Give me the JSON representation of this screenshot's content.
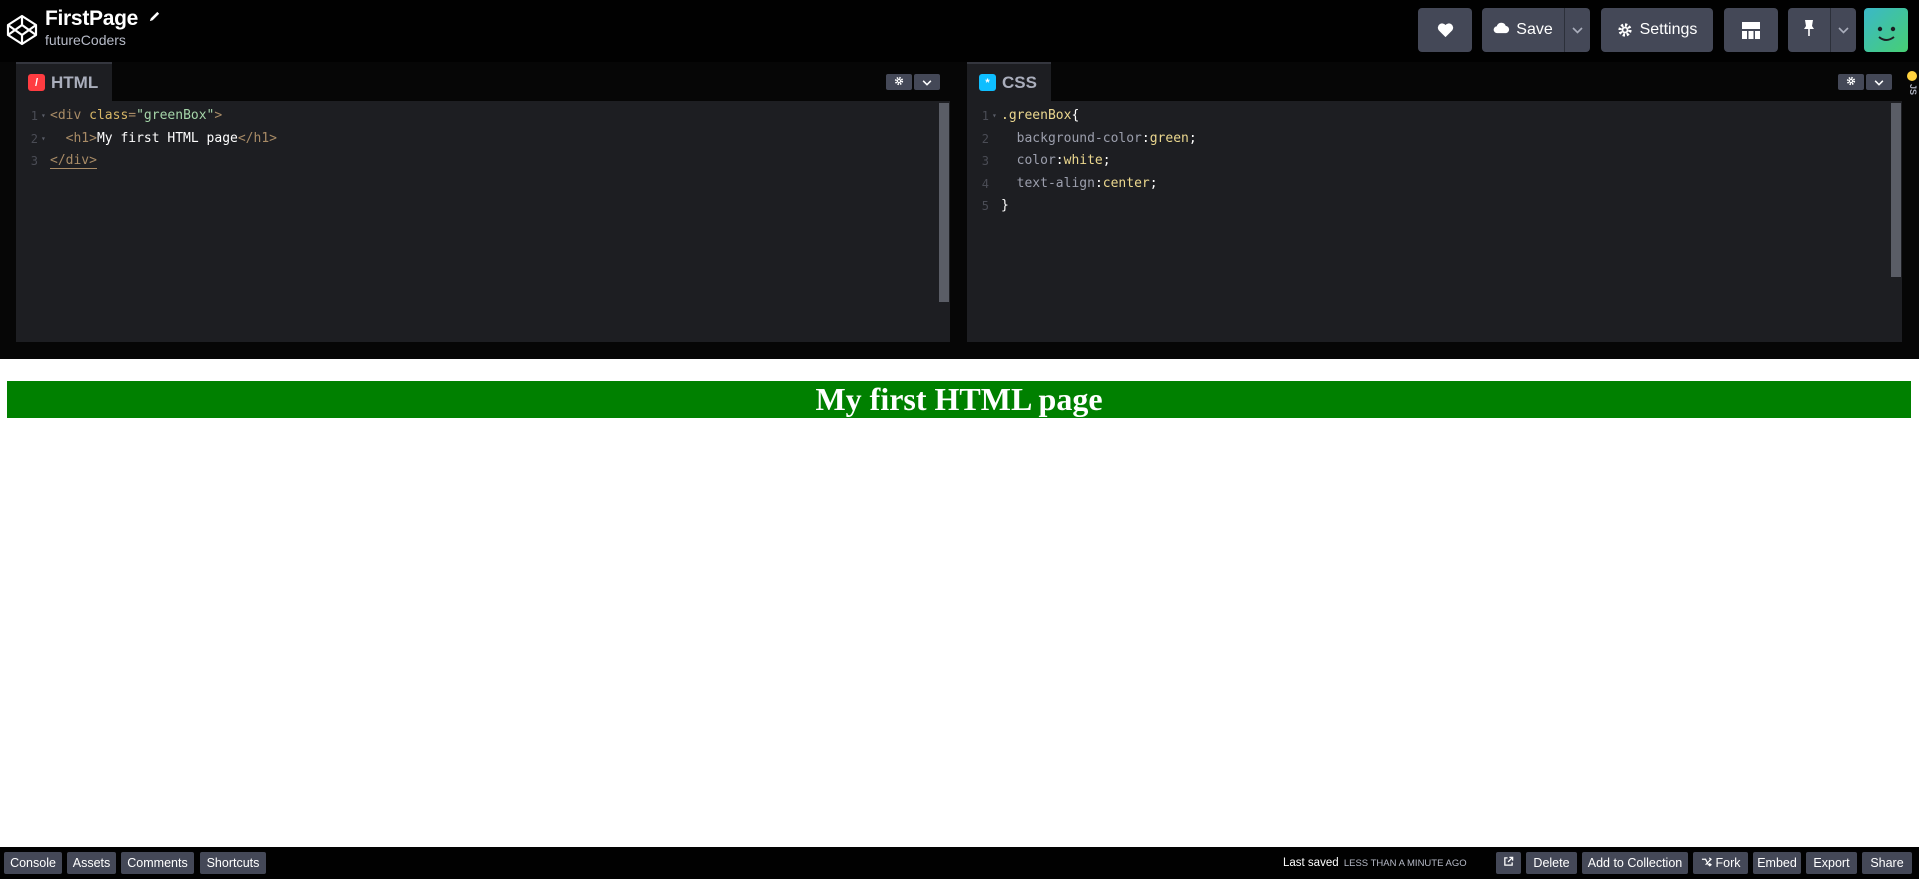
{
  "header": {
    "title": "FirstPage",
    "username": "futureCoders",
    "icons": {
      "logo": "codepen-logo-icon",
      "edit": "pencil-icon"
    },
    "buttons": {
      "like": {
        "icon": "heart-icon"
      },
      "save": {
        "label": "Save",
        "icon": "cloud-icon"
      },
      "settings": {
        "label": "Settings",
        "icon": "gear-icon"
      },
      "layout": {
        "icon": "layout-icon"
      },
      "pin": {
        "icon": "pin-icon"
      }
    }
  },
  "editors": {
    "html": {
      "tab_label": "HTML",
      "icon": "html-icon",
      "accent": "#ff3c41",
      "lines": [
        {
          "num": "1",
          "fold": true,
          "indent": "",
          "parts": [
            {
              "t": "<div ",
              "c": "tag"
            },
            {
              "t": "class",
              "c": "attr"
            },
            {
              "t": "=",
              "c": "tag"
            },
            {
              "t": "\"greenBox\"",
              "c": "str"
            },
            {
              "t": ">",
              "c": "tag"
            }
          ]
        },
        {
          "num": "2",
          "fold": true,
          "indent": "  ",
          "parts": [
            {
              "t": "<h1>",
              "c": "tag"
            },
            {
              "t": "My first HTML page",
              "c": "text"
            },
            {
              "t": "</h1>",
              "c": "tag"
            }
          ]
        },
        {
          "num": "3",
          "fold": false,
          "indent": "",
          "parts": [
            {
              "t": "</div>",
              "c": "tag"
            }
          ]
        }
      ]
    },
    "css": {
      "tab_label": "CSS",
      "icon": "css-icon",
      "accent": "#0ebeff",
      "lines": [
        {
          "num": "1",
          "fold": true,
          "indent": "",
          "parts": [
            {
              "t": ".greenBox",
              "c": "sel"
            },
            {
              "t": "{",
              "c": "punc"
            }
          ]
        },
        {
          "num": "2",
          "fold": false,
          "indent": "  ",
          "parts": [
            {
              "t": "background-color",
              "c": "prop"
            },
            {
              "t": ":",
              "c": "punc"
            },
            {
              "t": "green",
              "c": "val"
            },
            {
              "t": ";",
              "c": "punc"
            }
          ]
        },
        {
          "num": "3",
          "fold": false,
          "indent": "  ",
          "parts": [
            {
              "t": "color",
              "c": "prop"
            },
            {
              "t": ":",
              "c": "punc"
            },
            {
              "t": "white",
              "c": "val"
            },
            {
              "t": ";",
              "c": "punc"
            }
          ]
        },
        {
          "num": "4",
          "fold": false,
          "indent": "  ",
          "parts": [
            {
              "t": "text-align",
              "c": "prop"
            },
            {
              "t": ":",
              "c": "punc"
            },
            {
              "t": "center",
              "c": "val"
            },
            {
              "t": ";",
              "c": "punc"
            }
          ]
        },
        {
          "num": "5",
          "fold": false,
          "indent": "",
          "parts": [
            {
              "t": "}",
              "c": "punc"
            }
          ]
        }
      ]
    },
    "js": {
      "tab_label": "JS"
    }
  },
  "preview": {
    "heading": "My first HTML page",
    "box_color": "#008000"
  },
  "footer": {
    "buttons": {
      "console": "Console",
      "assets": "Assets",
      "comments": "Comments",
      "shortcuts": "Shortcuts",
      "delete": "Delete",
      "add_to_collection": "Add to Collection",
      "fork": "Fork",
      "embed": "Embed",
      "export": "Export",
      "share": "Share"
    },
    "last_saved_label": "Last saved",
    "last_saved_when": "LESS THAN A MINUTE AGO",
    "icons": {
      "open_external": "external-link-icon",
      "fork": "fork-icon"
    }
  }
}
